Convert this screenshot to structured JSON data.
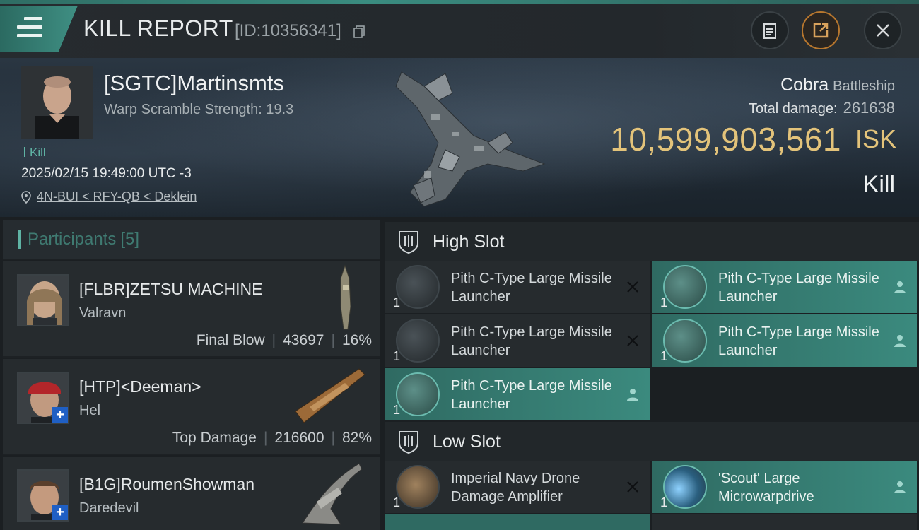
{
  "topbar": {
    "title": "KILL REPORT",
    "report_id": "[ID:10356341]",
    "icons": [
      "menu-icon",
      "copy-icon",
      "clipboard-icon",
      "share-icon",
      "close-icon"
    ]
  },
  "victim": {
    "name": "[SGTC]Martinsmts",
    "scramble_label": "Warp Scramble Strength: 19.3",
    "kill_tag": "Kill",
    "datetime": "2025/02/15 19:49:00 UTC -3",
    "location": "4N-BUI < RFY-QB < Deklein",
    "ship_name": "Cobra",
    "ship_class": "Battleship",
    "total_damage_label": "Total damage:",
    "total_damage": "261638",
    "isk_value": "10,599,903,561",
    "isk_unit": "ISK",
    "result": "Kill"
  },
  "participants": {
    "title": "Participants",
    "count": "[5]",
    "rows": [
      {
        "name": "[FLBR]ZETSU MACHINE",
        "ship": "Valravn",
        "role": "Final Blow",
        "damage": "43697",
        "percent": "16%"
      },
      {
        "name": "[HTP]<Deeman>",
        "ship": "Hel",
        "role": "Top Damage",
        "damage": "216600",
        "percent": "82%"
      },
      {
        "name": "[B1G]RoumenShowman",
        "ship": "Daredevil"
      }
    ]
  },
  "slots": {
    "high": {
      "label": "High Slot",
      "items": [
        {
          "name": "Pith C-Type Large Missile Launcher",
          "qty": "1",
          "status": "destroyed"
        },
        {
          "name": "Pith C-Type Large Missile Launcher",
          "qty": "1",
          "status": "dropped"
        },
        {
          "name": "Pith C-Type Large Missile Launcher",
          "qty": "1",
          "status": "destroyed"
        },
        {
          "name": "Pith C-Type Large Missile Launcher",
          "qty": "1",
          "status": "dropped"
        },
        {
          "name": "Pith C-Type Large Missile Launcher",
          "qty": "1",
          "status": "dropped"
        }
      ]
    },
    "low": {
      "label": "Low Slot",
      "items": [
        {
          "name": "Imperial Navy Drone Damage Amplifier",
          "qty": "1",
          "status": "destroyed"
        },
        {
          "name": "'Scout' Large Microwarpdrive",
          "qty": "1",
          "status": "dropped"
        }
      ]
    }
  },
  "colors": {
    "accent": "#3b8a7e",
    "isk": "#e3c37a",
    "background": "#1b1f22"
  }
}
